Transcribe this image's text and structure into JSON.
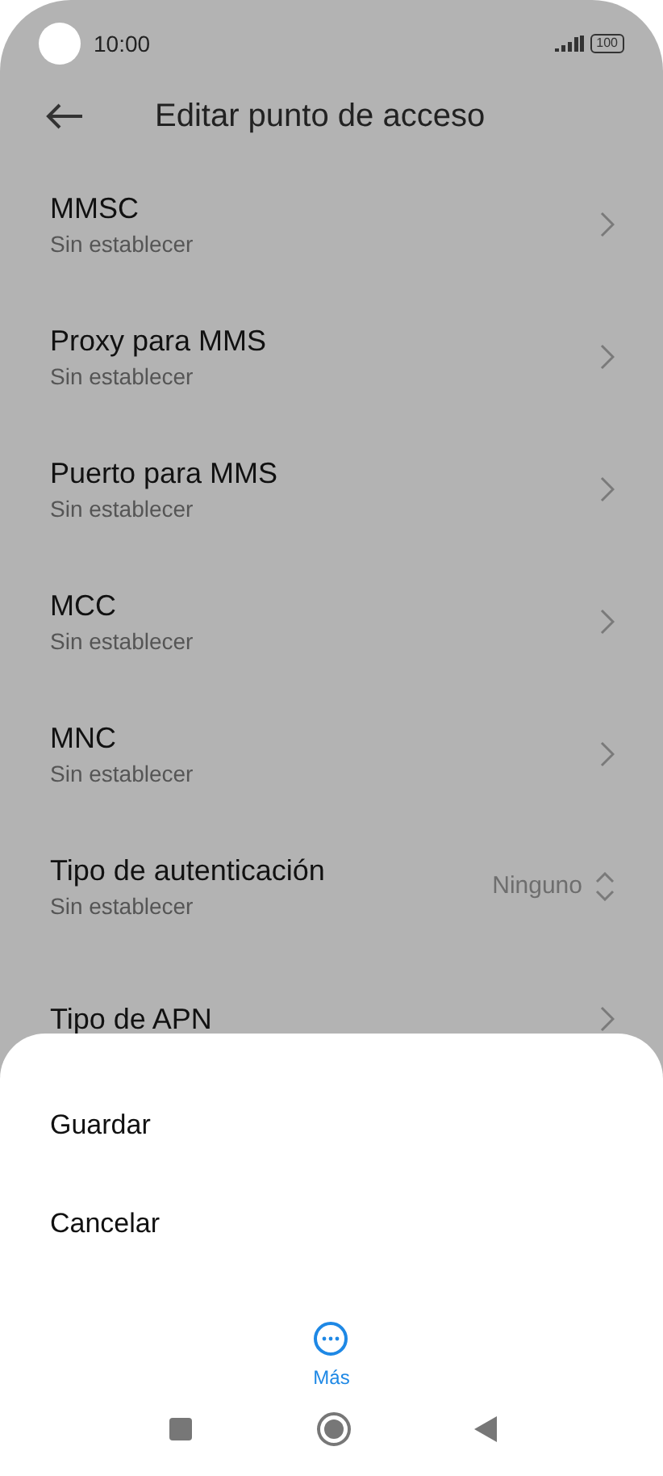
{
  "status_bar": {
    "time": "10:00",
    "battery": "100"
  },
  "header": {
    "title": "Editar punto de acceso"
  },
  "settings": [
    {
      "kind": "link",
      "title": "MMSC",
      "subtitle": "Sin establecer"
    },
    {
      "kind": "link",
      "title": "Proxy para MMS",
      "subtitle": "Sin establecer"
    },
    {
      "kind": "link",
      "title": "Puerto para MMS",
      "subtitle": "Sin establecer"
    },
    {
      "kind": "link",
      "title": "MCC",
      "subtitle": "Sin establecer"
    },
    {
      "kind": "link",
      "title": "MNC",
      "subtitle": "Sin establecer"
    },
    {
      "kind": "select",
      "title": "Tipo de autenticación",
      "subtitle": "Sin establecer",
      "value": "Ninguno"
    },
    {
      "kind": "link",
      "title": "Tipo de APN"
    }
  ],
  "sheet": {
    "actions": [
      "Guardar",
      "Cancelar"
    ],
    "more": "Más"
  }
}
